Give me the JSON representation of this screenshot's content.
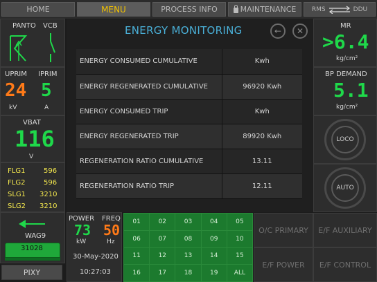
{
  "nav": {
    "home": "HOME",
    "menu": "MENU",
    "process_info": "PROCESS INFO",
    "maintenance": "MAINTENANCE",
    "rms": "RMS",
    "ddu": "DDU"
  },
  "left": {
    "panto": "PANTO",
    "vcb": "VCB",
    "uprim_label": "UPRIM",
    "iprim_label": "IPRIM",
    "uprim_value": "24",
    "iprim_value": "5",
    "uprim_unit": "kV",
    "iprim_unit": "A",
    "vbat_label": "VBAT",
    "vbat_value": "116",
    "vbat_unit": "V",
    "flags": [
      {
        "name": "FLG1",
        "value": "596"
      },
      {
        "name": "FLG2",
        "value": "596"
      },
      {
        "name": "SLG1",
        "value": "3210"
      },
      {
        "name": "SLG2",
        "value": "3210"
      }
    ],
    "loco_class": "WAG9",
    "loco_number": "31028",
    "pixy": "PIXY"
  },
  "center": {
    "title": "ENERGY MONITORING",
    "rows": [
      {
        "label": "ENERGY CONSUMED CUMULATIVE",
        "value": "Kwh"
      },
      {
        "label": "ENERGY REGENERATED CUMULATIVE",
        "value": "96920 Kwh"
      },
      {
        "label": "ENERGY CONSUMED TRIP",
        "value": "Kwh"
      },
      {
        "label": "ENERGY REGENERATED TRIP",
        "value": "89920 Kwh"
      },
      {
        "label": "REGENERATION RATIO CUMULATIVE",
        "value": "13.11"
      },
      {
        "label": "REGENERATION RATIO TRIP",
        "value": "12.11"
      }
    ]
  },
  "right": {
    "mr_label": "MR",
    "mr_value": ">6.4",
    "mr_unit": "kg/cm²",
    "bp_label": "BP DEMAND",
    "bp_value": "5.1",
    "bp_unit": "kg/cm²",
    "loco": "LOCO",
    "auto": "AUTO"
  },
  "bottom": {
    "power_label": "POWER",
    "freq_label": "FREQ",
    "power_value": "73",
    "freq_value": "50",
    "power_unit": "kW",
    "freq_unit": "Hz",
    "date": "30-May-2020",
    "time": "10:27:03",
    "grid": [
      "01",
      "02",
      "03",
      "04",
      "05",
      "06",
      "07",
      "08",
      "09",
      "10",
      "11",
      "12",
      "13",
      "14",
      "15",
      "16",
      "17",
      "18",
      "19",
      "ALL"
    ],
    "oc_primary": "O/C PRIMARY",
    "ef_auxiliary": "E/F AUXILIARY",
    "ef_power": "E/F POWER",
    "ef_control": "E/F CONTROL"
  },
  "colors": {
    "accent": "#f2c200",
    "title": "#4ab0d8",
    "green": "#1fd84a",
    "orange": "#ff7a18",
    "grid": "#1c7a2e"
  }
}
